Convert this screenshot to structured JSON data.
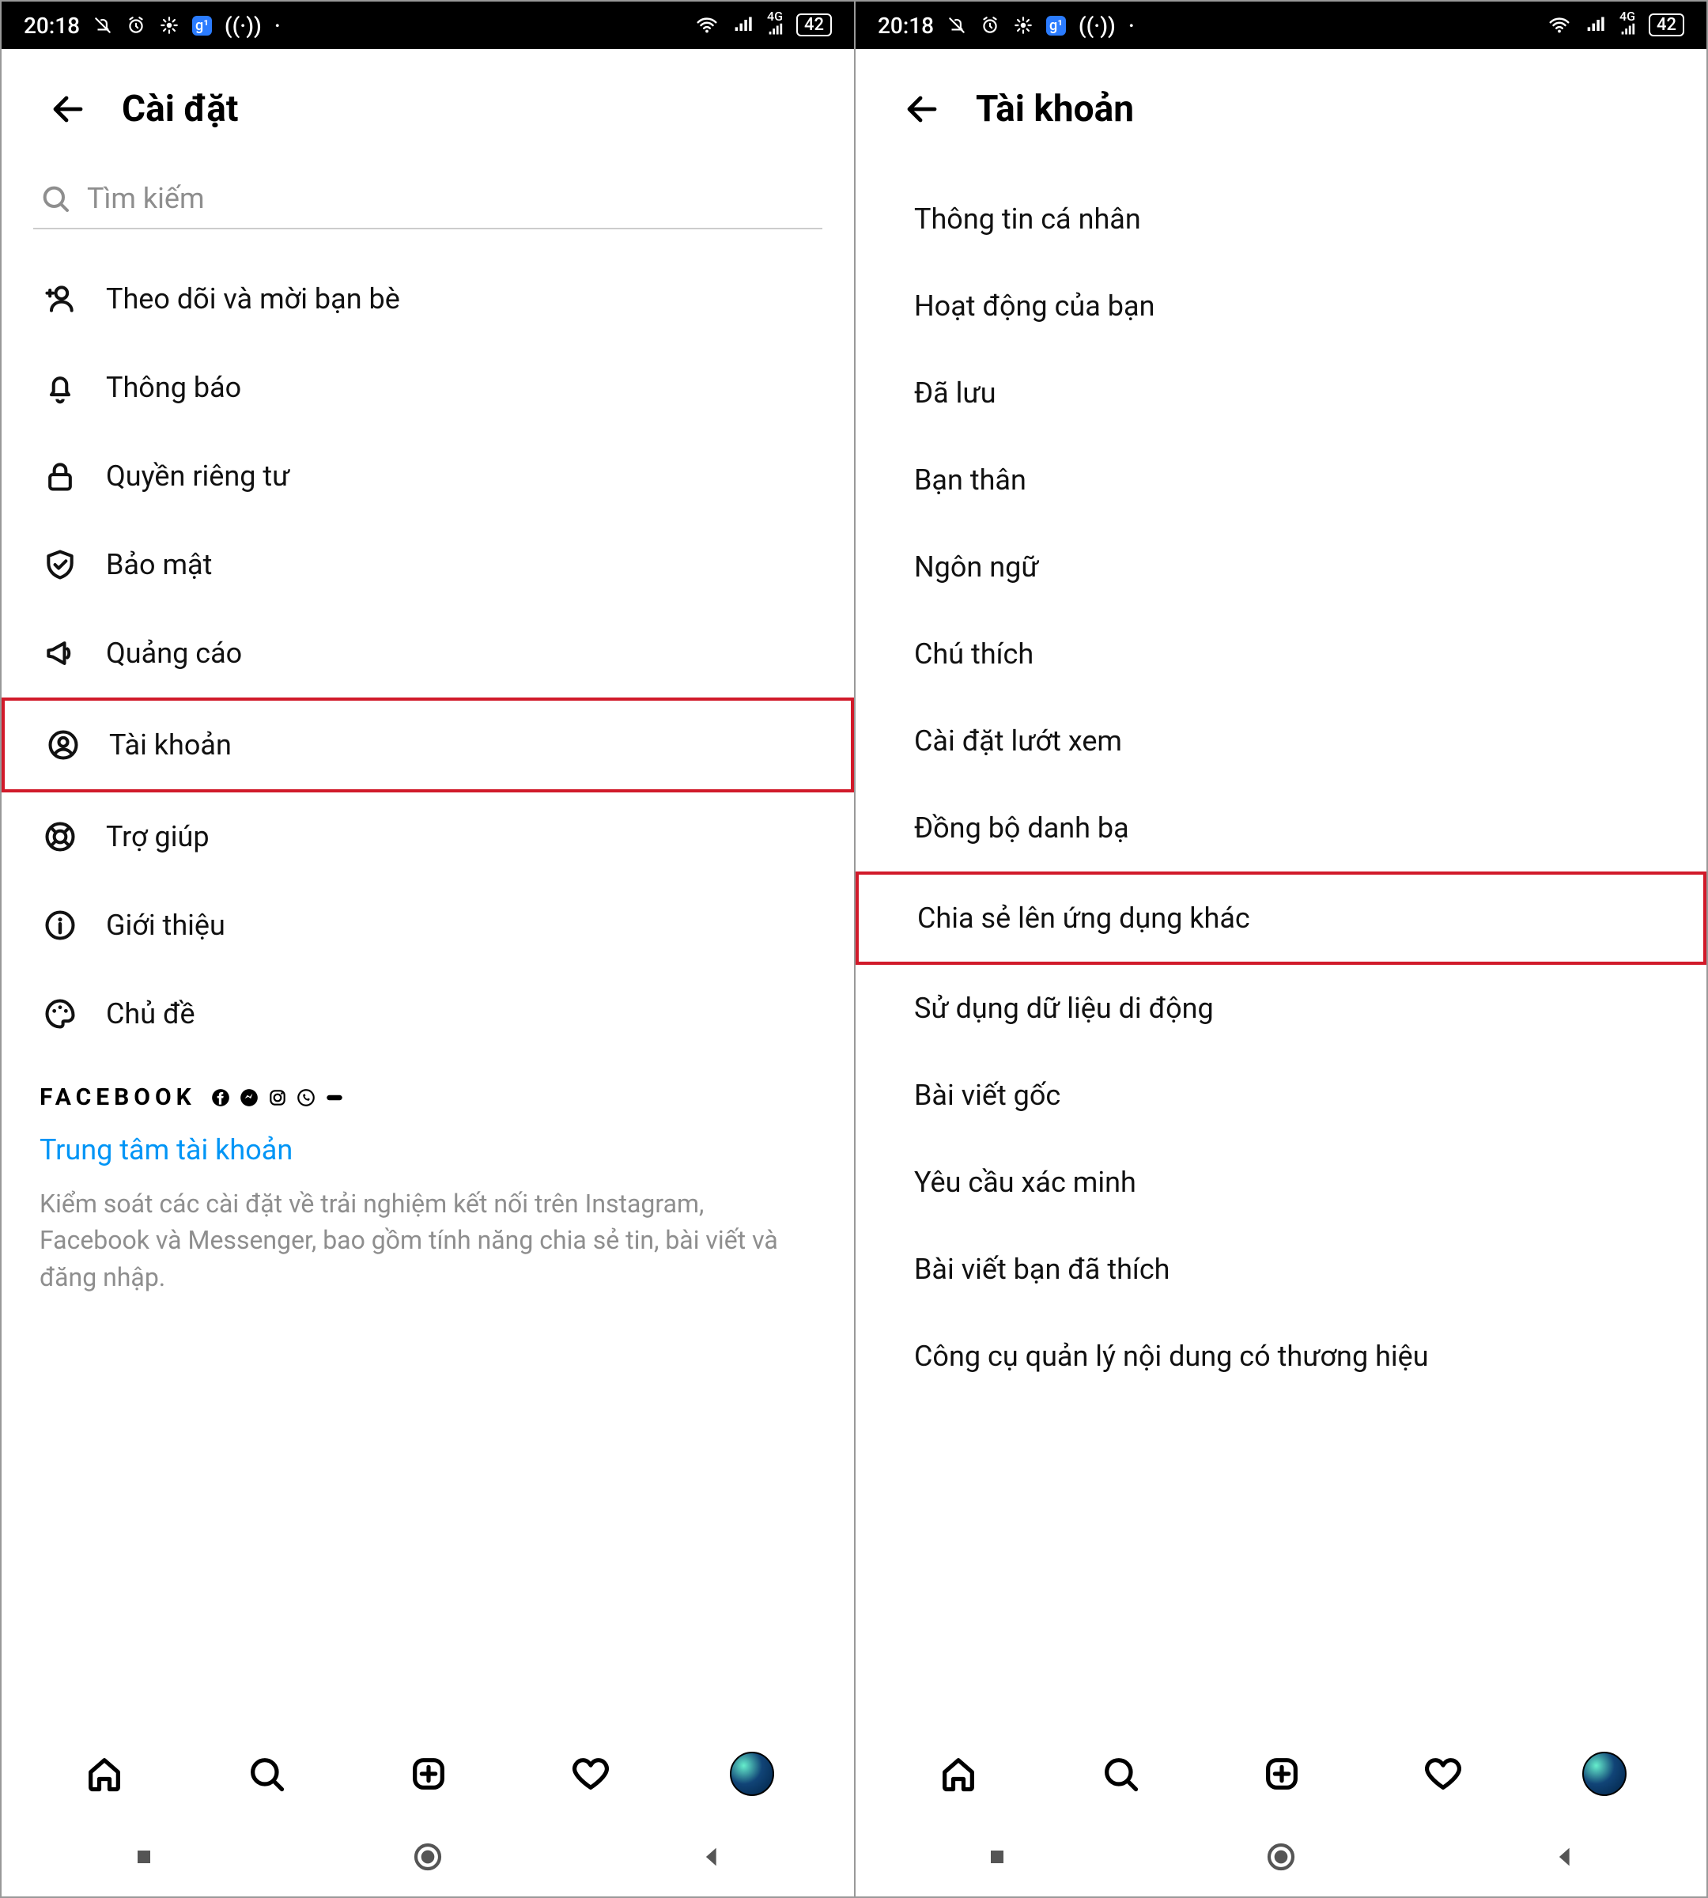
{
  "statusbar": {
    "time": "20:18",
    "battery": "42"
  },
  "left": {
    "title": "Cài đặt",
    "search_placeholder": "Tìm kiếm",
    "items": [
      {
        "icon": "user-plus",
        "label": "Theo dõi và mời bạn bè"
      },
      {
        "icon": "bell",
        "label": "Thông báo"
      },
      {
        "icon": "lock",
        "label": "Quyền riêng tư"
      },
      {
        "icon": "shield",
        "label": "Bảo mật"
      },
      {
        "icon": "megaphone",
        "label": "Quảng cáo"
      },
      {
        "icon": "user-circle",
        "label": "Tài khoản",
        "highlight": true
      },
      {
        "icon": "lifebuoy",
        "label": "Trợ giúp"
      },
      {
        "icon": "info",
        "label": "Giới thiệu"
      },
      {
        "icon": "palette",
        "label": "Chủ đề"
      }
    ],
    "fb": {
      "heading": "FACEBOOK",
      "link": "Trung tâm tài khoản",
      "desc": "Kiểm soát các cài đặt về trải nghiệm kết nối trên Instagram, Facebook và Messenger, bao gồm tính năng chia sẻ tin, bài viết và đăng nhập."
    }
  },
  "right": {
    "title": "Tài khoản",
    "items": [
      {
        "label": "Thông tin cá nhân"
      },
      {
        "label": "Hoạt động của bạn"
      },
      {
        "label": "Đã lưu"
      },
      {
        "label": "Bạn thân"
      },
      {
        "label": "Ngôn ngữ"
      },
      {
        "label": "Chú thích"
      },
      {
        "label": "Cài đặt lướt xem"
      },
      {
        "label": "Đồng bộ danh bạ"
      },
      {
        "label": "Chia sẻ lên ứng dụng khác",
        "highlight": true
      },
      {
        "label": "Sử dụng dữ liệu di động"
      },
      {
        "label": "Bài viết gốc"
      },
      {
        "label": "Yêu cầu xác minh"
      },
      {
        "label": "Bài viết bạn đã thích"
      },
      {
        "label": "Công cụ quản lý nội dung có thương hiệu"
      }
    ]
  }
}
